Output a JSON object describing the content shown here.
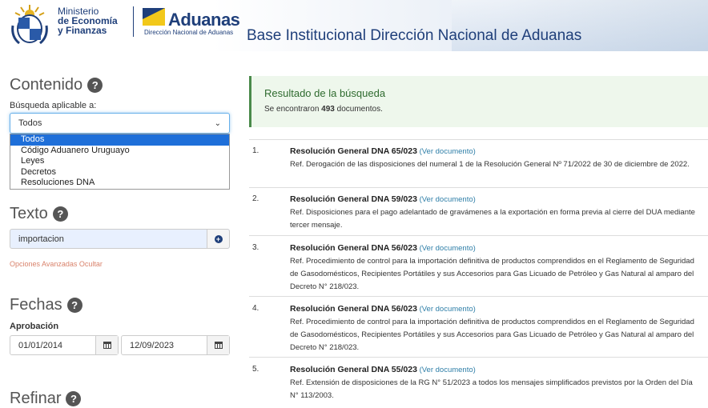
{
  "header": {
    "ministerio_line1": "Ministerio",
    "ministerio_line2": "de Economía",
    "ministerio_line3": "y Finanzas",
    "aduanas_name": "Aduanas",
    "aduanas_sub": "Dirección Nacional de Aduanas",
    "site_title": "Base Institucional Dirección Nacional de Aduanas"
  },
  "sidebar": {
    "contenido_title": "Contenido",
    "busqueda_label": "Búsqueda aplicable a:",
    "select_value": "Todos",
    "dropdown_options": [
      "Todos",
      "Código Aduanero Uruguayo",
      "Leyes",
      "Decretos",
      "Resoluciones DNA"
    ],
    "texto_title": "Texto",
    "texto_value": "importacion",
    "opciones_link": "Opciones Avanzadas Ocultar",
    "fechas_title": "Fechas",
    "aprobacion_label": "Aprobación",
    "date_from": "01/01/2014",
    "date_to": "12/09/2023",
    "refinar_title": "Refinar"
  },
  "results": {
    "title": "Resultado de la búsqueda",
    "count_prefix": "Se encontraron",
    "count": "493",
    "count_suffix": "documentos.",
    "link_label": "(Ver documento)",
    "items": [
      {
        "num": "1.",
        "title": "Resolución General DNA 65/023",
        "ref": "Ref. Derogación de las disposiciones del numeral 1 de la Resolución General Nº 71/2022 de 30 de diciembre de 2022."
      },
      {
        "num": "2.",
        "title": "Resolución General DNA 59/023",
        "ref": "Ref. Disposiciones para el pago adelantado de gravámenes a la exportación en forma previa al cierre del DUA mediante tercer mensaje."
      },
      {
        "num": "3.",
        "title": "Resolución General DNA 56/023",
        "ref": "Ref. Procedimiento de control para la importación definitiva de productos comprendidos en el Reglamento de Seguridad de Gasodomésticos, Recipientes Portátiles y sus Accesorios para Gas Licuado de Petróleo y Gas Natural al amparo del Decreto N° 218/023."
      },
      {
        "num": "4.",
        "title": "Resolución General DNA 56/023",
        "ref": "Ref. Procedimiento de control para la importación definitiva de productos comprendidos en el Reglamento de Seguridad de Gasodomésticos, Recipientes Portátiles y sus Accesorios para Gas Licuado de Petróleo y Gas Natural al amparo del Decreto N° 218/023."
      },
      {
        "num": "5.",
        "title": "Resolución General DNA 55/023",
        "ref": "Ref. Extensión de disposiciones de la RG N° 51/2023 a todos los mensajes simplificados previstos por la Orden del Día N° 113/2003."
      }
    ]
  },
  "colors": {
    "brand_blue": "#1f3f7a",
    "link": "#2f7fa8",
    "result_green": "#2f6b2f",
    "dropdown_selected": "#1e6fd9"
  }
}
